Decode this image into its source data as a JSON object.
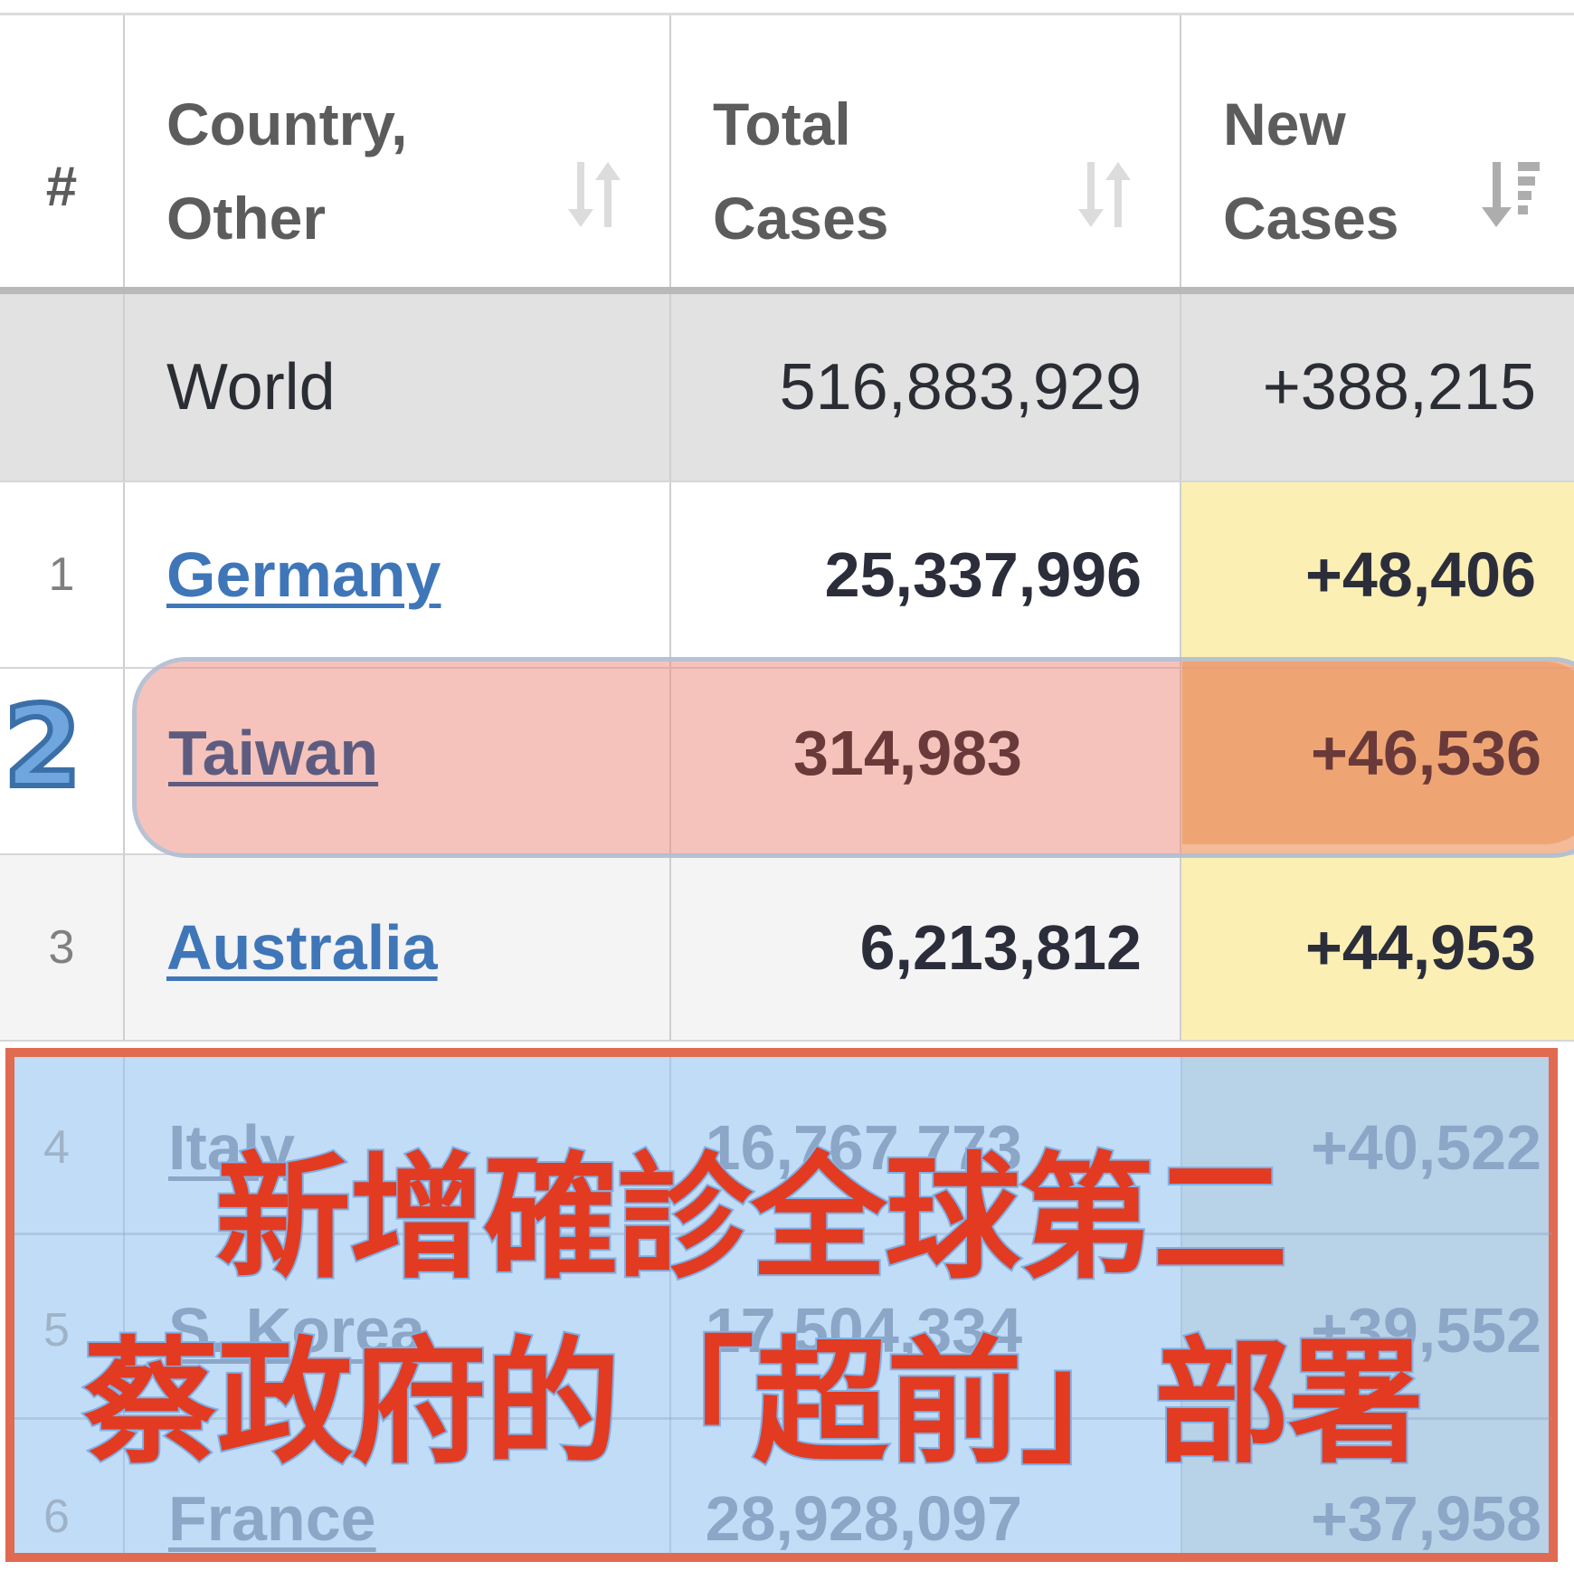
{
  "table": {
    "headers": {
      "rank": "#",
      "country_line1": "Country,",
      "country_line2": "Other",
      "total_line1": "Total",
      "total_line2": "Cases",
      "new_line1": "New",
      "new_line2": "Cases"
    },
    "world": {
      "name": "World",
      "total_cases": "516,883,929",
      "new_cases": "+388,215"
    },
    "rows": [
      {
        "rank": "1",
        "country": "Germany",
        "total_cases": "25,337,996",
        "new_cases": "+48,406"
      },
      {
        "rank": "2",
        "country": "Taiwan",
        "total_cases": "314,983",
        "new_cases": "+46,536"
      },
      {
        "rank": "3",
        "country": "Australia",
        "total_cases": "6,213,812",
        "new_cases": "+44,953"
      },
      {
        "rank": "4",
        "country": "Italy",
        "total_cases": "16,767,773",
        "new_cases": "+40,522"
      },
      {
        "rank": "5",
        "country": "S. Korea",
        "total_cases": "17,504,334",
        "new_cases": "+39,552"
      },
      {
        "rank": "6",
        "country": "France",
        "total_cases": "28,928,097",
        "new_cases": "+37,958"
      }
    ],
    "sort_icons": {
      "country": "sort-both-icon",
      "total": "sort-both-icon",
      "new": "sort-descending-active-icon"
    }
  },
  "annotations": {
    "rank_badge": "2",
    "headline_line1": "新增確診全球第二",
    "headline_line2": "蔡政府的「超前」部署"
  },
  "colors": {
    "link": "#3f76b8",
    "new_cases_highlight": "#fbefb4",
    "taiwan_highlight": "#ec8c7d",
    "overlay_bg": "#b6d6f4",
    "overlay_border": "#e06b50",
    "headline": "#e23b22"
  }
}
